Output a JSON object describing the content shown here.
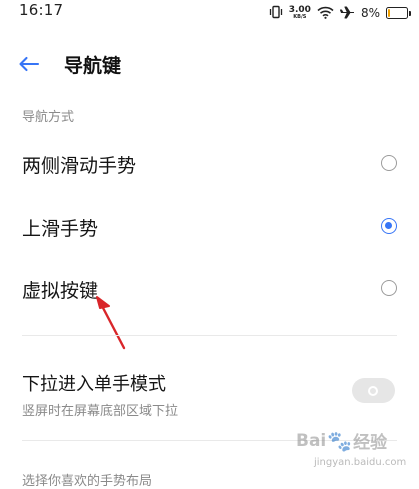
{
  "status_bar": {
    "time": "16:17",
    "net_speed_value": "3.00",
    "net_speed_unit": "KB/S",
    "battery_percent": "8%",
    "battery_level": 0.08,
    "battery_color": "#f2a100",
    "icons": [
      "vibrate-icon",
      "wifi-icon",
      "airplane-icon",
      "battery-icon"
    ]
  },
  "header": {
    "back_icon": "back-arrow-icon",
    "title": "导航键"
  },
  "nav_section": {
    "label": "导航方式",
    "options": [
      {
        "label": "两侧滑动手势",
        "selected": false
      },
      {
        "label": "上滑手势",
        "selected": true
      },
      {
        "label": "虚拟按键",
        "selected": false
      }
    ]
  },
  "one_hand": {
    "title": "下拉进入单手模式",
    "subtitle": "竖屏时在屏幕底部区域下拉",
    "enabled": false
  },
  "bottom_section": {
    "label": "选择你喜欢的手势布局"
  },
  "annotation": {
    "type": "red-arrow",
    "color": "#d9262a",
    "points_to": "虚拟按键"
  },
  "watermark": {
    "logo_left": "Bai",
    "logo_paw": "🐾",
    "logo_right": "经验",
    "url": "jingyan.baidu.com"
  },
  "colors": {
    "accent": "#3775f6",
    "toggle_off": "#e6e6e6"
  }
}
